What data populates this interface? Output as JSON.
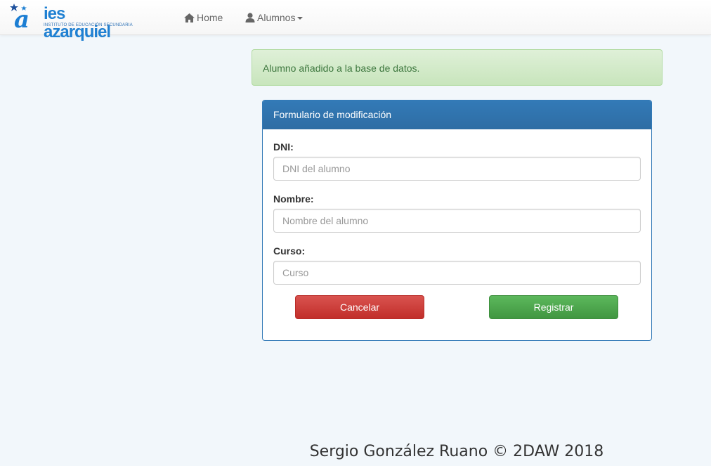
{
  "navbar": {
    "logo": {
      "brand": "ies azarquiel",
      "subtitle": "INSTITUTO DE EDUCACIÓN SECUNDARIA"
    },
    "items": [
      {
        "label": "Home",
        "icon": "home-icon"
      },
      {
        "label": "Alumnos",
        "icon": "user-icon",
        "dropdown": true
      }
    ]
  },
  "alert": {
    "message": "Alumno añadido a la base de datos.",
    "type": "success"
  },
  "form": {
    "title": "Formulario de modificación",
    "fields": [
      {
        "label": "DNI:",
        "placeholder": "DNI del alumno",
        "value": ""
      },
      {
        "label": "Nombre:",
        "placeholder": "Nombre del alumno",
        "value": ""
      },
      {
        "label": "Curso:",
        "placeholder": "Curso",
        "value": ""
      }
    ],
    "cancel_label": "Cancelar",
    "submit_label": "Registrar"
  },
  "footer": {
    "text": "Sergio González Ruano © 2DAW 2018"
  },
  "colors": {
    "primary": "#337ab7",
    "success": "#5cb85c",
    "danger": "#d9534f",
    "alert_bg": "#dff0d8",
    "alert_text": "#3c763d",
    "page_bg": "#f2f7fb"
  }
}
